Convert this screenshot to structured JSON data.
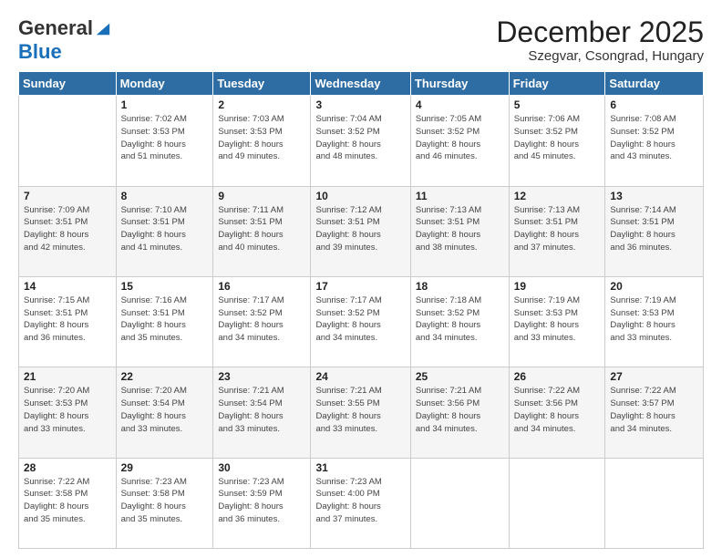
{
  "header": {
    "logo_general": "General",
    "logo_blue": "Blue",
    "month_title": "December 2025",
    "location": "Szegvar, Csongrad, Hungary"
  },
  "weekdays": [
    "Sunday",
    "Monday",
    "Tuesday",
    "Wednesday",
    "Thursday",
    "Friday",
    "Saturday"
  ],
  "weeks": [
    [
      {
        "day": "",
        "info": ""
      },
      {
        "day": "1",
        "info": "Sunrise: 7:02 AM\nSunset: 3:53 PM\nDaylight: 8 hours\nand 51 minutes."
      },
      {
        "day": "2",
        "info": "Sunrise: 7:03 AM\nSunset: 3:53 PM\nDaylight: 8 hours\nand 49 minutes."
      },
      {
        "day": "3",
        "info": "Sunrise: 7:04 AM\nSunset: 3:52 PM\nDaylight: 8 hours\nand 48 minutes."
      },
      {
        "day": "4",
        "info": "Sunrise: 7:05 AM\nSunset: 3:52 PM\nDaylight: 8 hours\nand 46 minutes."
      },
      {
        "day": "5",
        "info": "Sunrise: 7:06 AM\nSunset: 3:52 PM\nDaylight: 8 hours\nand 45 minutes."
      },
      {
        "day": "6",
        "info": "Sunrise: 7:08 AM\nSunset: 3:52 PM\nDaylight: 8 hours\nand 43 minutes."
      }
    ],
    [
      {
        "day": "7",
        "info": "Sunrise: 7:09 AM\nSunset: 3:51 PM\nDaylight: 8 hours\nand 42 minutes."
      },
      {
        "day": "8",
        "info": "Sunrise: 7:10 AM\nSunset: 3:51 PM\nDaylight: 8 hours\nand 41 minutes."
      },
      {
        "day": "9",
        "info": "Sunrise: 7:11 AM\nSunset: 3:51 PM\nDaylight: 8 hours\nand 40 minutes."
      },
      {
        "day": "10",
        "info": "Sunrise: 7:12 AM\nSunset: 3:51 PM\nDaylight: 8 hours\nand 39 minutes."
      },
      {
        "day": "11",
        "info": "Sunrise: 7:13 AM\nSunset: 3:51 PM\nDaylight: 8 hours\nand 38 minutes."
      },
      {
        "day": "12",
        "info": "Sunrise: 7:13 AM\nSunset: 3:51 PM\nDaylight: 8 hours\nand 37 minutes."
      },
      {
        "day": "13",
        "info": "Sunrise: 7:14 AM\nSunset: 3:51 PM\nDaylight: 8 hours\nand 36 minutes."
      }
    ],
    [
      {
        "day": "14",
        "info": "Sunrise: 7:15 AM\nSunset: 3:51 PM\nDaylight: 8 hours\nand 36 minutes."
      },
      {
        "day": "15",
        "info": "Sunrise: 7:16 AM\nSunset: 3:51 PM\nDaylight: 8 hours\nand 35 minutes."
      },
      {
        "day": "16",
        "info": "Sunrise: 7:17 AM\nSunset: 3:52 PM\nDaylight: 8 hours\nand 34 minutes."
      },
      {
        "day": "17",
        "info": "Sunrise: 7:17 AM\nSunset: 3:52 PM\nDaylight: 8 hours\nand 34 minutes."
      },
      {
        "day": "18",
        "info": "Sunrise: 7:18 AM\nSunset: 3:52 PM\nDaylight: 8 hours\nand 34 minutes."
      },
      {
        "day": "19",
        "info": "Sunrise: 7:19 AM\nSunset: 3:53 PM\nDaylight: 8 hours\nand 33 minutes."
      },
      {
        "day": "20",
        "info": "Sunrise: 7:19 AM\nSunset: 3:53 PM\nDaylight: 8 hours\nand 33 minutes."
      }
    ],
    [
      {
        "day": "21",
        "info": "Sunrise: 7:20 AM\nSunset: 3:53 PM\nDaylight: 8 hours\nand 33 minutes."
      },
      {
        "day": "22",
        "info": "Sunrise: 7:20 AM\nSunset: 3:54 PM\nDaylight: 8 hours\nand 33 minutes."
      },
      {
        "day": "23",
        "info": "Sunrise: 7:21 AM\nSunset: 3:54 PM\nDaylight: 8 hours\nand 33 minutes."
      },
      {
        "day": "24",
        "info": "Sunrise: 7:21 AM\nSunset: 3:55 PM\nDaylight: 8 hours\nand 33 minutes."
      },
      {
        "day": "25",
        "info": "Sunrise: 7:21 AM\nSunset: 3:56 PM\nDaylight: 8 hours\nand 34 minutes."
      },
      {
        "day": "26",
        "info": "Sunrise: 7:22 AM\nSunset: 3:56 PM\nDaylight: 8 hours\nand 34 minutes."
      },
      {
        "day": "27",
        "info": "Sunrise: 7:22 AM\nSunset: 3:57 PM\nDaylight: 8 hours\nand 34 minutes."
      }
    ],
    [
      {
        "day": "28",
        "info": "Sunrise: 7:22 AM\nSunset: 3:58 PM\nDaylight: 8 hours\nand 35 minutes."
      },
      {
        "day": "29",
        "info": "Sunrise: 7:23 AM\nSunset: 3:58 PM\nDaylight: 8 hours\nand 35 minutes."
      },
      {
        "day": "30",
        "info": "Sunrise: 7:23 AM\nSunset: 3:59 PM\nDaylight: 8 hours\nand 36 minutes."
      },
      {
        "day": "31",
        "info": "Sunrise: 7:23 AM\nSunset: 4:00 PM\nDaylight: 8 hours\nand 37 minutes."
      },
      {
        "day": "",
        "info": ""
      },
      {
        "day": "",
        "info": ""
      },
      {
        "day": "",
        "info": ""
      }
    ]
  ]
}
